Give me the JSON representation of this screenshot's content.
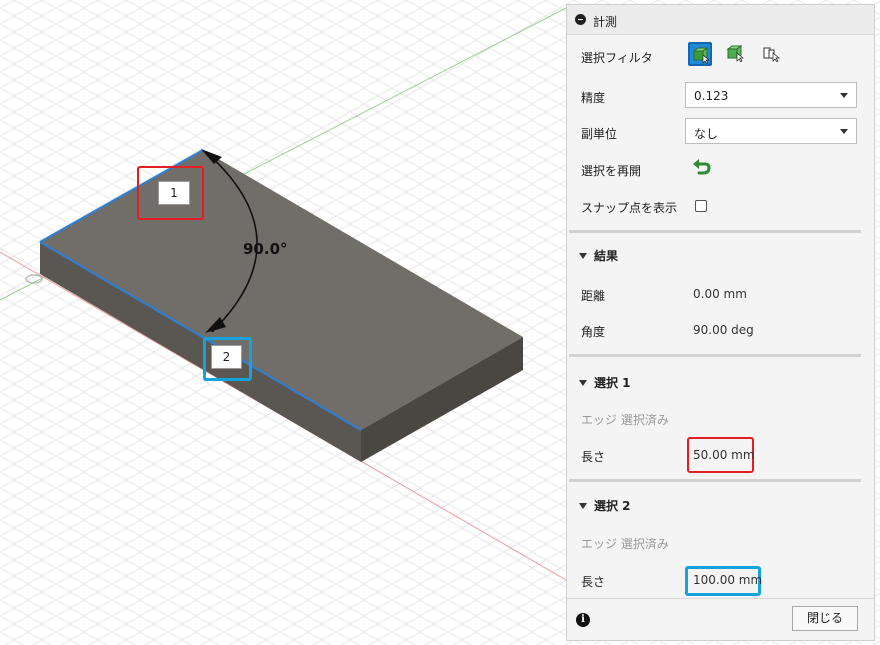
{
  "panel": {
    "title": "計測",
    "selection_filter": {
      "label": "選択フィルタ",
      "icons": [
        "select-face-icon",
        "select-body-icon",
        "select-component-icon"
      ],
      "active_index": 0
    },
    "precision": {
      "label": "精度",
      "value": "0.123"
    },
    "sub_unit": {
      "label": "副単位",
      "value": "なし"
    },
    "restart_selection": {
      "label": "選択を再開"
    },
    "show_snap_points": {
      "label": "スナップ点を表示",
      "checked": false
    },
    "results": {
      "heading": "結果",
      "distance": {
        "label": "距離",
        "value": "0.00 mm"
      },
      "angle": {
        "label": "角度",
        "value": "90.00 deg"
      }
    },
    "selection1": {
      "heading": "選択 1",
      "status": "エッジ 選択済み",
      "length": {
        "label": "長さ",
        "value": "50.00 mm"
      }
    },
    "selection2": {
      "heading": "選択 2",
      "status": "エッジ 選択済み",
      "length": {
        "label": "長さ",
        "value": "100.00 mm"
      }
    },
    "close_label": "閉じる"
  },
  "viewport": {
    "callout1": "1",
    "callout2": "2",
    "angle_label": "90.0°"
  },
  "colors": {
    "accent_blue": "#1f8ad8",
    "highlight_red": "#e01e24",
    "highlight_blue": "#16a3dc",
    "body_top": "#716d68",
    "body_front": "#5a5651",
    "body_side": "#4a4642",
    "edge_blue": "#2d7fd8"
  }
}
